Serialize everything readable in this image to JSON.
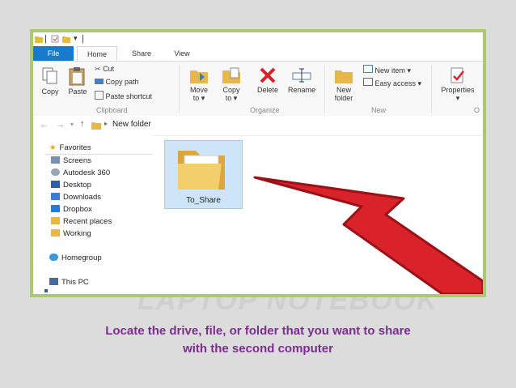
{
  "ribbon_tabs": [
    "File",
    "Home",
    "Share",
    "View"
  ],
  "ribbon": {
    "copy": "Copy",
    "paste": "Paste",
    "cut": "Cut",
    "copy_path": "Copy path",
    "paste_shortcut": "Paste shortcut",
    "move_to": "Move",
    "move_to2": "to ▾",
    "copy_to": "Copy",
    "copy_to2": "to ▾",
    "delete": "Delete",
    "rename": "Rename",
    "new_folder": "New",
    "new_folder2": "folder",
    "new_item": "New item ▾",
    "easy_access": "Easy access ▾",
    "properties": "Properties",
    "groups": {
      "clipboard": "Clipboard",
      "organize": "Organize",
      "new": "New",
      "open": "O"
    }
  },
  "address": {
    "path": "New folder"
  },
  "nav": {
    "favorites": "Favorites",
    "items": [
      "Screens",
      "Autodesk 360",
      "Desktop",
      "Downloads",
      "Dropbox",
      "Recent places",
      "Working"
    ],
    "homegroup": "Homegroup",
    "this_pc": "This PC"
  },
  "folder": {
    "name": "To_Share"
  },
  "watermark": "LAPTOP NOTEBOOK",
  "caption": {
    "line1": "Locate the drive, file, or folder that you want to share",
    "line2": "with the second computer"
  },
  "colors": {
    "accent": "#1979ca",
    "arrow": "#d9222a",
    "frame": "#a9c878",
    "caption": "#7b2e8e"
  }
}
